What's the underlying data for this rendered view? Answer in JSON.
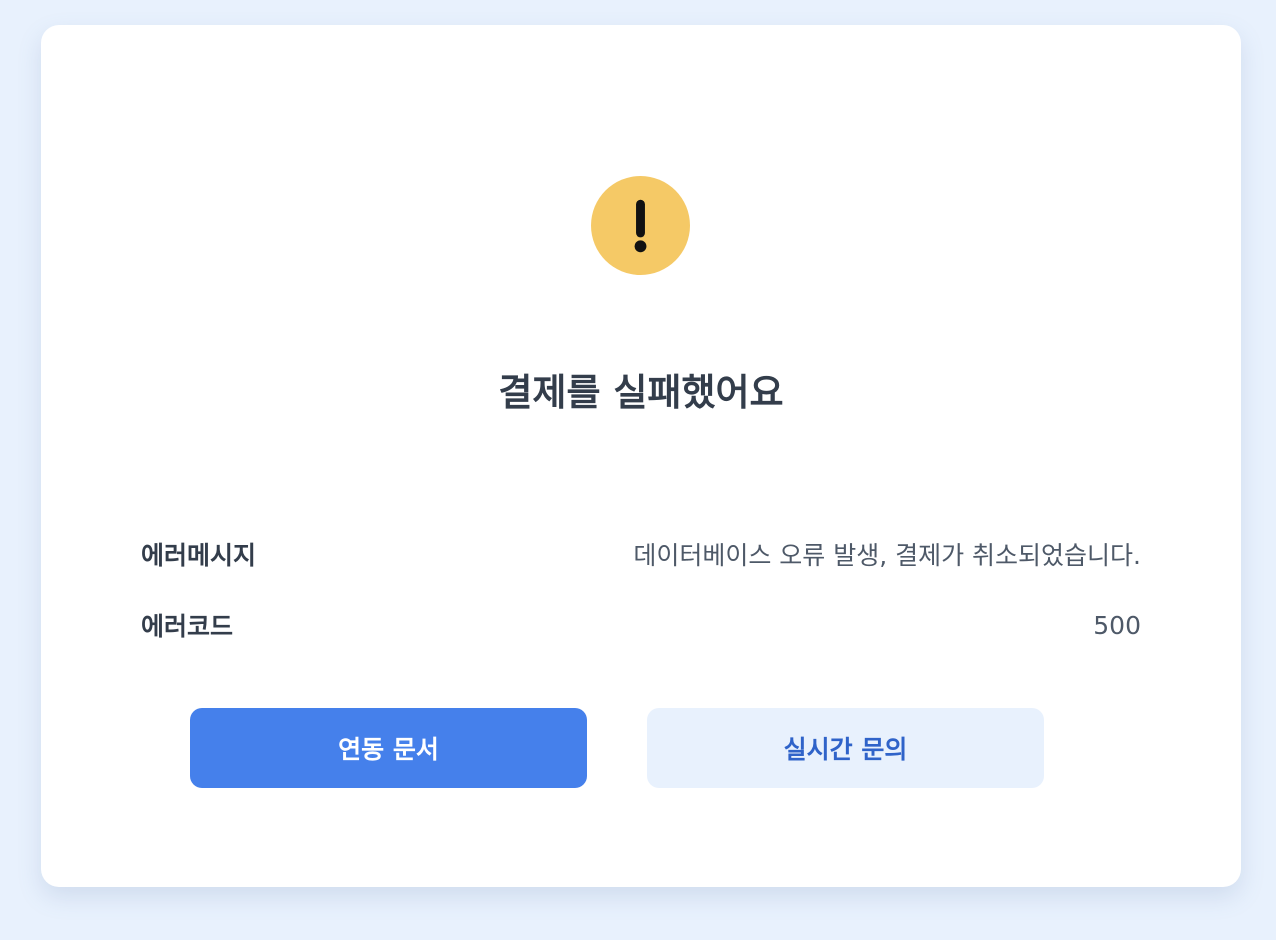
{
  "result": {
    "title": "결제를 실패했어요",
    "icon": "warning-exclamation-icon",
    "icon_color": "#f5c966"
  },
  "details": {
    "message_label": "에러메시지",
    "message_value": "데이터베이스 오류 발생, 결제가 취소되었습니다.",
    "code_label": "에러코드",
    "code_value": "500"
  },
  "actions": {
    "docs_label": "연동 문서",
    "inquiry_label": "실시간 문의"
  },
  "colors": {
    "background": "#e8f1fd",
    "primary": "#4580eb",
    "secondary_bg": "#e8f1fd",
    "secondary_text": "#2f63c9",
    "text": "#333d4b"
  }
}
